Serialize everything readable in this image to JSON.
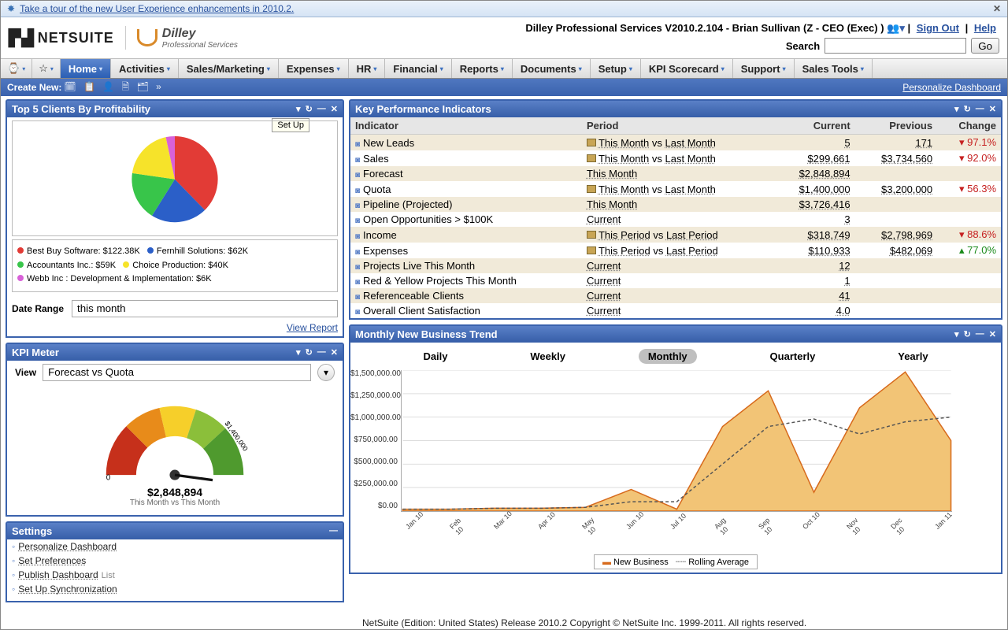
{
  "tour_bar": {
    "text": "Take a tour of the new User Experience enhancements in 2010.2."
  },
  "masthead": {
    "netsuite": "NETSUITE",
    "dilley": "Dilley",
    "dilley_sub": "Professional Services",
    "title": "Dilley Professional Services V2010.2.104 - Brian Sullivan (Z - CEO (Exec) )",
    "sign_out": "Sign Out",
    "help": "Help",
    "search_label": "Search",
    "go_label": "Go"
  },
  "nav": {
    "items": [
      "Home",
      "Activities",
      "Sales/Marketing",
      "Expenses",
      "HR",
      "Financial",
      "Reports",
      "Documents",
      "Setup",
      "KPI Scorecard",
      "Support",
      "Sales Tools"
    ]
  },
  "subbar": {
    "create_new": "Create New:",
    "personalize": "Personalize Dashboard"
  },
  "top5": {
    "title": "Top 5 Clients By Profitability",
    "setup_tip": "Set Up",
    "date_range_label": "Date Range",
    "date_range_value": "this month",
    "view_report": "View Report",
    "legend": [
      {
        "label": "Best Buy Software: $122.38K",
        "color": "#e23b36"
      },
      {
        "label": "Fernhill Solutions: $62K",
        "color": "#2b5fc8"
      },
      {
        "label": "Accountants Inc.: $59K",
        "color": "#38c54a"
      },
      {
        "label": "Choice Production: $40K",
        "color": "#f6e32a"
      },
      {
        "label": "Webb Inc : Development & Implementation: $6K",
        "color": "#d861d8"
      }
    ]
  },
  "kpi": {
    "title": "Key Performance Indicators",
    "headers": {
      "indicator": "Indicator",
      "period": "Period",
      "current": "Current",
      "previous": "Previous",
      "change": "Change"
    },
    "rows": [
      {
        "name": "New Leads",
        "spark": true,
        "p1": "This Month",
        "vs": " vs ",
        "p2": "Last Month",
        "current": "5",
        "previous": "171",
        "change": "97.1%",
        "dir": "down"
      },
      {
        "name": "Sales",
        "spark": true,
        "p1": "This Month",
        "vs": " vs ",
        "p2": "Last Month",
        "current": "$299,661",
        "previous": "$3,734,560",
        "change": "92.0%",
        "dir": "down"
      },
      {
        "name": "Forecast",
        "spark": false,
        "p1": "This Month",
        "vs": "",
        "p2": "",
        "current": "$2,848,894",
        "previous": "",
        "change": "",
        "dir": ""
      },
      {
        "name": "Quota",
        "spark": true,
        "p1": "This Month",
        "vs": " vs ",
        "p2": "Last Month",
        "current": "$1,400,000",
        "previous": "$3,200,000",
        "change": "56.3%",
        "dir": "down"
      },
      {
        "name": "Pipeline (Projected)",
        "spark": false,
        "p1": "This Month",
        "vs": "",
        "p2": "",
        "current": "$3,726,416",
        "previous": "",
        "change": "",
        "dir": ""
      },
      {
        "name": "Open Opportunities > $100K",
        "spark": false,
        "p1": "Current",
        "vs": "",
        "p2": "",
        "current": "3",
        "previous": "",
        "change": "",
        "dir": ""
      },
      {
        "name": "Income",
        "spark": true,
        "p1": "This Period",
        "vs": " vs ",
        "p2": "Last Period",
        "current": "$318,749",
        "previous": "$2,798,969",
        "change": "88.6%",
        "dir": "down"
      },
      {
        "name": "Expenses",
        "spark": true,
        "p1": "This Period",
        "vs": " vs ",
        "p2": "Last Period",
        "current": "$110,933",
        "previous": "$482,069",
        "change": "77.0%",
        "dir": "up"
      },
      {
        "name": "Projects Live This Month",
        "spark": false,
        "p1": "Current",
        "vs": "",
        "p2": "",
        "current": "12",
        "previous": "",
        "change": "",
        "dir": ""
      },
      {
        "name": "Red & Yellow Projects This Month",
        "spark": false,
        "p1": "Current",
        "vs": "",
        "p2": "",
        "current": "1",
        "previous": "",
        "change": "",
        "dir": ""
      },
      {
        "name": "Referenceable Clients",
        "spark": false,
        "p1": "Current",
        "vs": "",
        "p2": "",
        "current": "41",
        "previous": "",
        "change": "",
        "dir": ""
      },
      {
        "name": "Overall Client Satisfaction",
        "spark": false,
        "p1": "Current",
        "vs": "",
        "p2": "",
        "current": "4.0",
        "previous": "",
        "change": "",
        "dir": ""
      }
    ]
  },
  "kpimeter": {
    "title": "KPI Meter",
    "view_label": "View",
    "view_value": "Forecast vs Quota",
    "scale_left": "0",
    "scale_right": "$1,400,000",
    "value": "$2,848,894",
    "sub": "This Month vs This Month"
  },
  "settings": {
    "title": "Settings",
    "items": [
      {
        "label": "Personalize Dashboard"
      },
      {
        "label": "Set Preferences"
      },
      {
        "label": "Publish Dashboard",
        "suffix": "List"
      },
      {
        "label": "Set Up Synchronization"
      }
    ]
  },
  "trend": {
    "title": "Monthly New Business Trend",
    "tabs": [
      "Daily",
      "Weekly",
      "Monthly",
      "Quarterly",
      "Yearly"
    ],
    "active_tab": "Monthly",
    "legend": {
      "series1": "New Business",
      "series2": "Rolling Average"
    }
  },
  "footer": "NetSuite (Edition: United States) Release 2010.2 Copyright © NetSuite Inc. 1999-2011. All rights reserved.",
  "chart_data": [
    {
      "type": "pie",
      "title": "Top 5 Clients By Profitability",
      "categories": [
        "Best Buy Software",
        "Fernhill Solutions",
        "Accountants Inc.",
        "Choice Production",
        "Webb Inc : Development & Implementation"
      ],
      "values": [
        122.38,
        62,
        59,
        40,
        6
      ],
      "unit": "$K",
      "colors": [
        "#e23b36",
        "#2b5fc8",
        "#38c54a",
        "#f6e32a",
        "#d861d8"
      ]
    },
    {
      "type": "gauge",
      "title": "KPI Meter — Forecast vs Quota",
      "min": 0,
      "max": 1400000,
      "value": 2848894,
      "bands": [
        {
          "color": "#c6301b"
        },
        {
          "color": "#e88b1a"
        },
        {
          "color": "#f6cf2a"
        },
        {
          "color": "#8bbf3a"
        },
        {
          "color": "#4f9a2e"
        }
      ]
    },
    {
      "type": "area",
      "title": "Monthly New Business Trend",
      "x": [
        "Jan 10",
        "Feb 10",
        "Mar 10",
        "Apr 10",
        "May 10",
        "Jun 10",
        "Jul 10",
        "Aug 10",
        "Sep 10",
        "Oct 10",
        "Nov 10",
        "Dec 10",
        "Jan 11"
      ],
      "ylim": [
        0,
        1500000
      ],
      "ylabel": "$",
      "yticks": [
        "$0.00",
        "$250,000.00",
        "$500,000.00",
        "$750,000.00",
        "$1,000,000.00",
        "$1,250,000.00",
        "$1,500,000.00"
      ],
      "series": [
        {
          "name": "New Business",
          "values": [
            20000,
            20000,
            30000,
            30000,
            40000,
            230000,
            20000,
            900000,
            1280000,
            200000,
            1100000,
            1480000,
            750000
          ]
        },
        {
          "name": "Rolling Average",
          "values": [
            20000,
            20000,
            30000,
            30000,
            40000,
            100000,
            100000,
            500000,
            900000,
            980000,
            820000,
            950000,
            1000000
          ]
        }
      ]
    }
  ]
}
